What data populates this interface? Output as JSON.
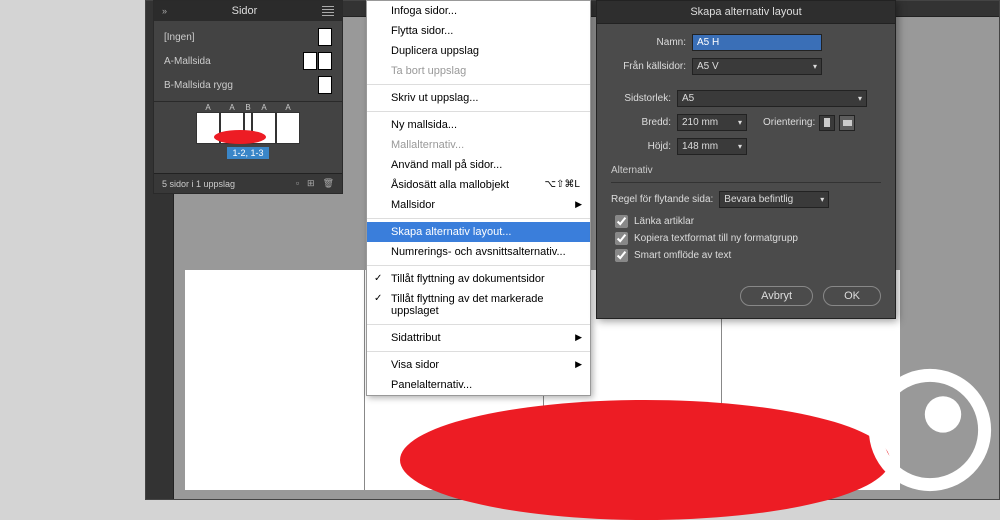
{
  "panel": {
    "title": "Sidor",
    "masters": {
      "none": "[Ingen]",
      "a": "A-Mallsida",
      "b": "B-Mallsida rygg"
    },
    "spread_labels": [
      "A",
      "A",
      "B",
      "A",
      "A"
    ],
    "page_numbers": "1-2, 1-3",
    "footer_status": "5 sidor i 1 uppslag"
  },
  "menu": {
    "insert": "Infoga sidor...",
    "move": "Flytta sidor...",
    "duplicate": "Duplicera uppslag",
    "delete": "Ta bort uppslag",
    "print": "Skriv ut uppslag...",
    "new_master": "Ny mallsida...",
    "master_options": "Mallalternativ...",
    "apply_master": "Använd mall på sidor...",
    "override": "Åsidosätt alla mallobjekt",
    "override_shortcut": "⌥⇧⌘L",
    "master_pages": "Mallsidor",
    "create_alt": "Skapa alternativ layout...",
    "numbering": "Numrerings- och avsnittsalternativ...",
    "allow_doc": "Tillåt flyttning av dokumentsidor",
    "allow_spread": "Tillåt flyttning av det markerade uppslaget",
    "page_attr": "Sidattribut",
    "view_pages": "Visa sidor",
    "panel_options": "Panelalternativ..."
  },
  "dialog": {
    "title": "Skapa alternativ layout",
    "name_label": "Namn:",
    "name_value": "A5 H",
    "source_label": "Från källsidor:",
    "source_value": "A5 V",
    "pagesize_label": "Sidstorlek:",
    "pagesize_value": "A5",
    "width_label": "Bredd:",
    "width_value": "210 mm",
    "height_label": "Höjd:",
    "height_value": "148 mm",
    "orientation_label": "Orientering:",
    "options_section": "Alternativ",
    "liquid_label": "Regel för flytande sida:",
    "liquid_value": "Bevara befintlig",
    "link_stories": "Länka artiklar",
    "copy_styles": "Kopiera textformat till ny formatgrupp",
    "smart_reflow": "Smart omflöde av text",
    "cancel": "Avbryt",
    "ok": "OK"
  }
}
